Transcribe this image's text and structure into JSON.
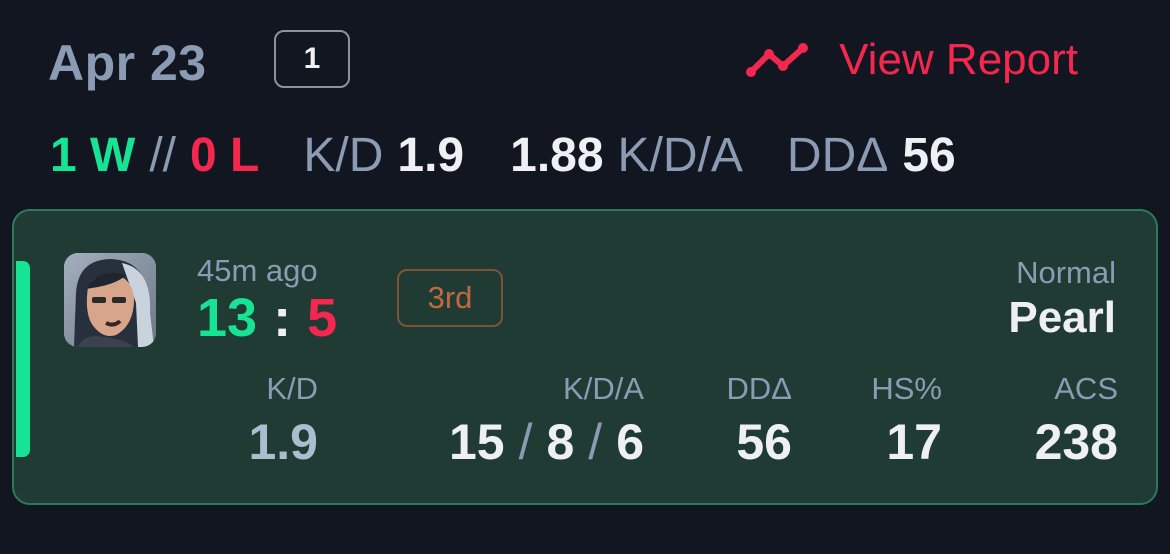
{
  "header": {
    "date": "Apr 23",
    "match_count": "1",
    "view_report_label": "View Report",
    "view_report_icon": "trend-line-icon"
  },
  "summary": {
    "wins": "1 W",
    "separator": "//",
    "losses": "0 L",
    "kd_label": "K/D",
    "kd_value": "1.9",
    "kda_value": "1.88",
    "kda_label": "K/D/A",
    "dda_label": "DDΔ",
    "dda_value": "56"
  },
  "match": {
    "time_ago": "45m ago",
    "score_ally": "13",
    "score_colon": ":",
    "score_enemy": "5",
    "placement": "3rd",
    "mode": "Normal",
    "map": "Pearl",
    "avatar_icon": "agent-portrait",
    "stats": {
      "kd_label": "K/D",
      "kd_value": "1.9",
      "kda_label": "K/D/A",
      "kills": "15",
      "deaths": "8",
      "assists": "6",
      "slash": "/",
      "dda_label": "DDΔ",
      "dda_value": "56",
      "hs_label": "HS%",
      "hs_value": "17",
      "acs_label": "ACS",
      "acs_value": "238"
    }
  },
  "colors": {
    "background": "#111620",
    "card": "#203b34",
    "card_border": "#2c7a5a",
    "win": "#17e394",
    "loss": "#f4274f",
    "muted": "#8a9bb3",
    "placement": "#c06a3c"
  }
}
